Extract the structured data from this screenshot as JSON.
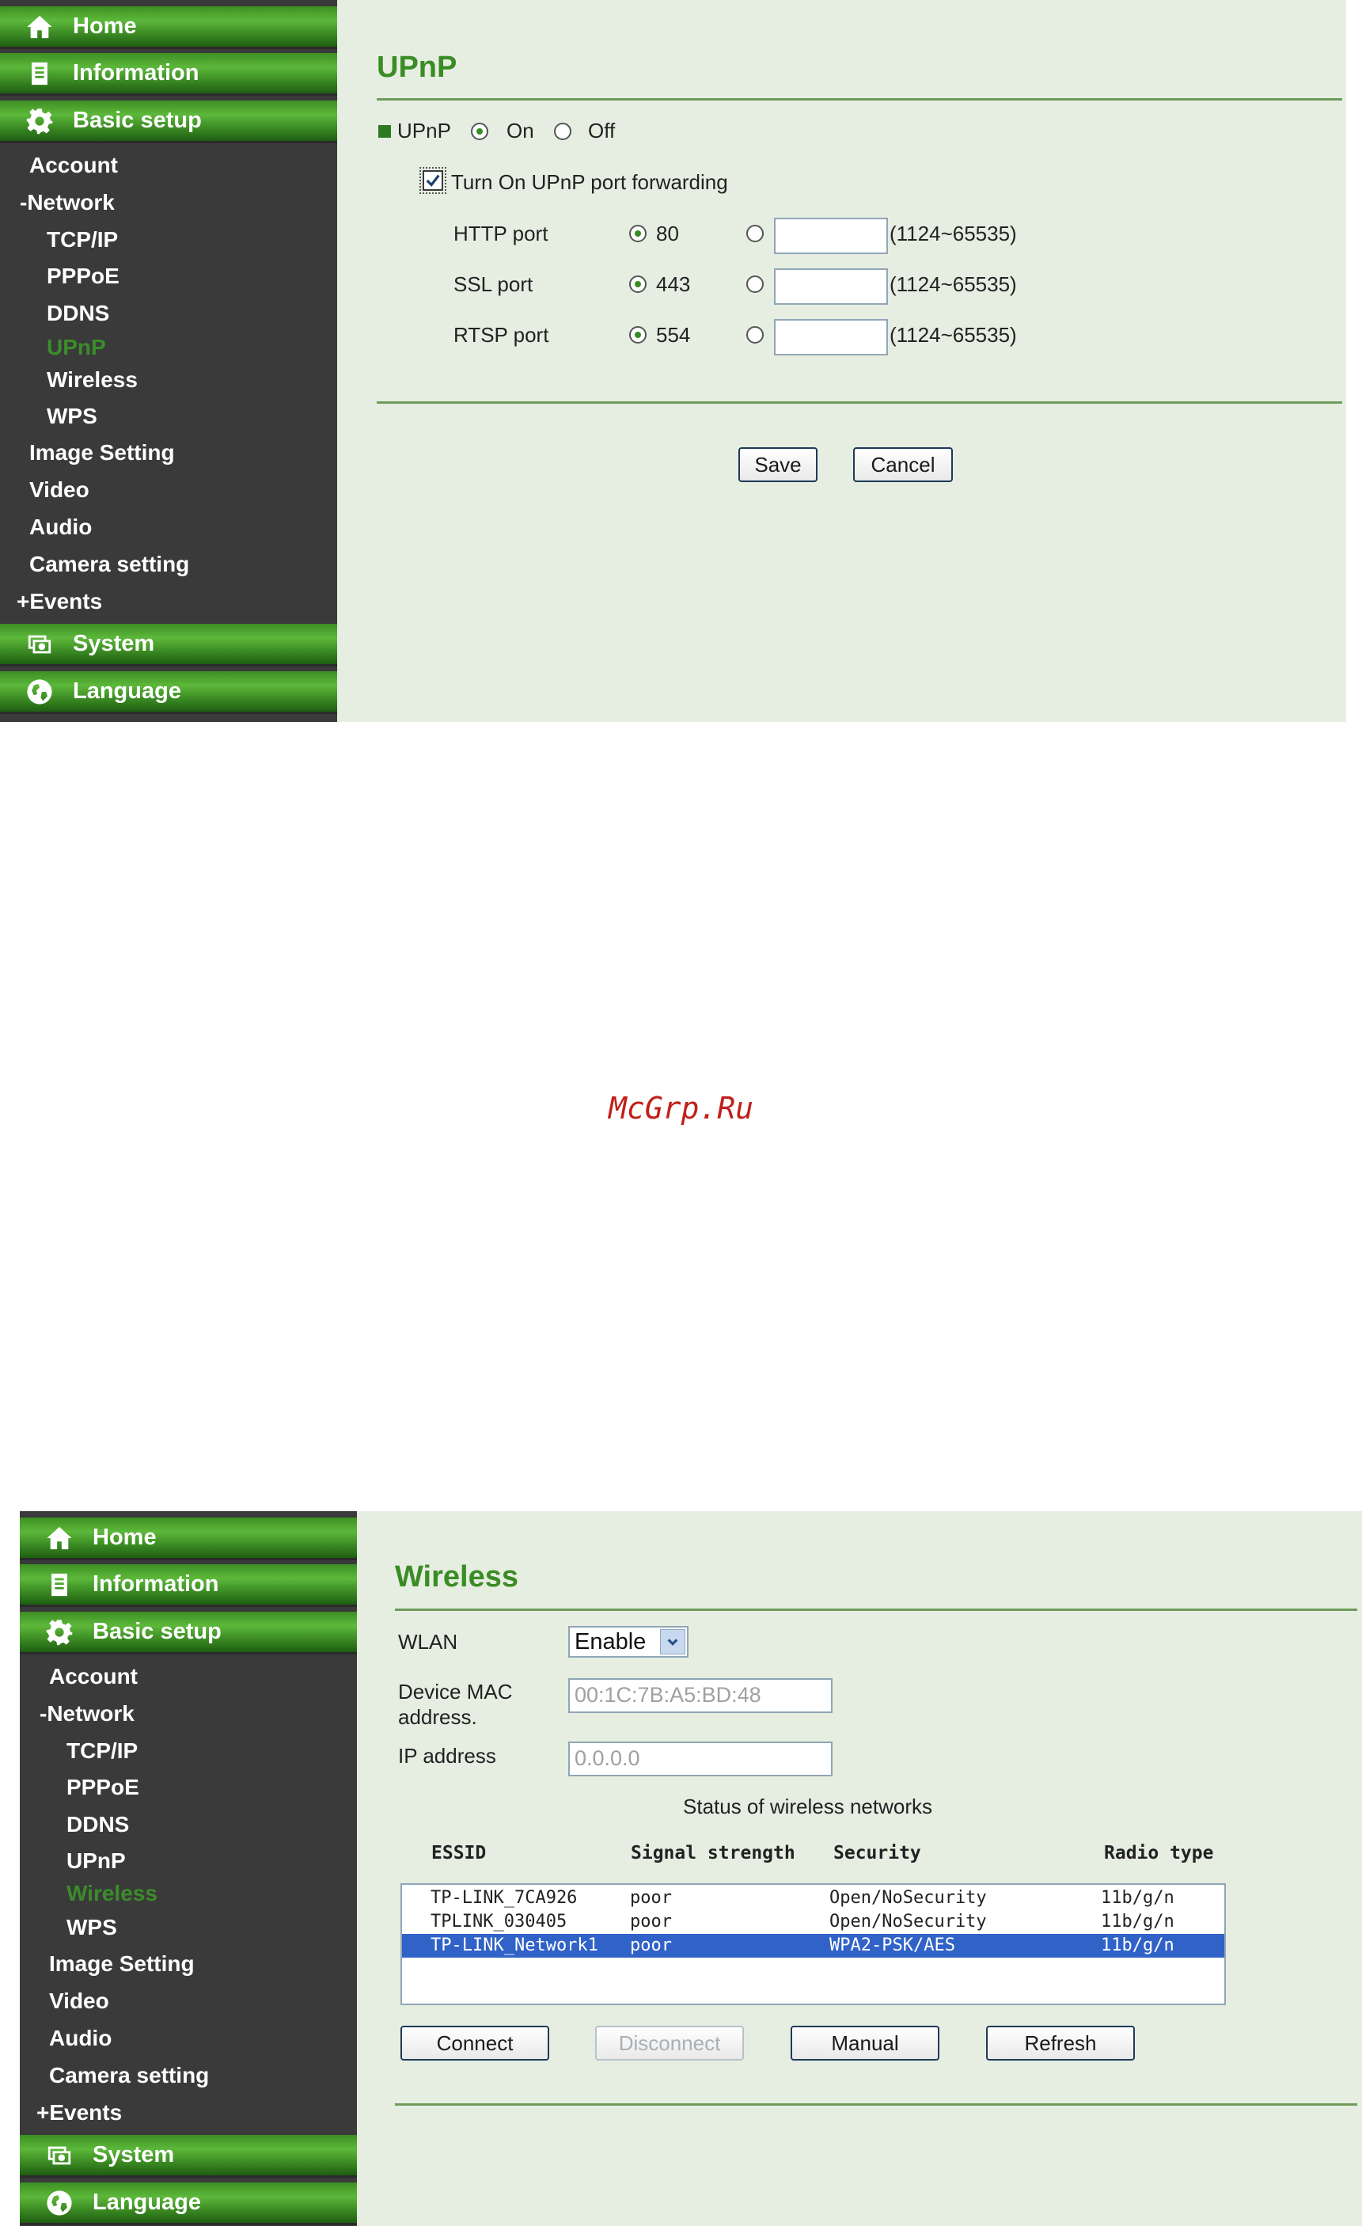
{
  "screen1": {
    "nav": {
      "home": "Home",
      "information": "Information",
      "basic_setup": "Basic setup",
      "items": [
        "Account",
        "-Network",
        "TCP/IP",
        "PPPoE",
        "DDNS",
        "UPnP",
        "Wireless",
        "WPS",
        "Image Setting",
        "Video",
        "Audio",
        "Camera setting",
        "+Events"
      ],
      "system": "System",
      "language": "Language",
      "active": "UPnP"
    },
    "title": "UPnP",
    "upnp_label": "UPnP",
    "on_label": "On",
    "off_label": "Off",
    "forwarding_label": "Turn On UPnP port forwarding",
    "ports": [
      {
        "label": "HTTP port",
        "default": "80",
        "range": "(1124~65535)"
      },
      {
        "label": "SSL port",
        "default": "443",
        "range": "(1124~65535)"
      },
      {
        "label": "RTSP port",
        "default": "554",
        "range": "(1124~65535)"
      }
    ],
    "save": "Save",
    "cancel": "Cancel"
  },
  "watermark": "McGrp.Ru",
  "screen2": {
    "nav": {
      "home": "Home",
      "information": "Information",
      "basic_setup": "Basic setup",
      "items": [
        "Account",
        "-Network",
        "TCP/IP",
        "PPPoE",
        "DDNS",
        "UPnP",
        "Wireless",
        "WPS",
        "Image Setting",
        "Video",
        "Audio",
        "Camera setting",
        "+Events"
      ],
      "system": "System",
      "language": "Language",
      "active": "Wireless"
    },
    "title": "Wireless",
    "wlan_label": "WLAN",
    "wlan_value": "Enable",
    "mac_label_1": "Device MAC",
    "mac_label_2": "address.",
    "mac_value": "00:1C:7B:A5:BD:48",
    "ip_label": "IP address",
    "ip_value": "0.0.0.0",
    "status_heading": "Status of wireless networks",
    "columns": [
      "ESSID",
      "Signal strength",
      "Security",
      "Radio type"
    ],
    "networks": [
      {
        "essid": "TP-LINK_7CA926",
        "signal": "poor",
        "security": "Open/NoSecurity",
        "radio": "11b/g/n"
      },
      {
        "essid": "TPLINK_030405",
        "signal": "poor",
        "security": "Open/NoSecurity",
        "radio": "11b/g/n"
      },
      {
        "essid": "TP-LINK_Network1",
        "signal": "poor",
        "security": "WPA2-PSK/AES",
        "radio": "11b/g/n"
      }
    ],
    "buttons": {
      "connect": "Connect",
      "disconnect": "Disconnect",
      "manual": "Manual",
      "refresh": "Refresh"
    }
  }
}
